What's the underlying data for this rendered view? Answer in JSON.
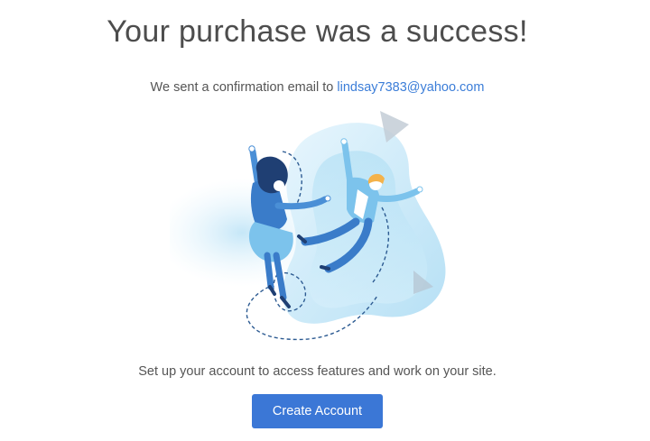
{
  "page": {
    "headline": "Your purchase was a success!",
    "confirmation_prefix": "We sent a confirmation email to ",
    "confirmation_email": "lindsay7383@yahoo.com",
    "setup_text": "Set up your account to access features and work on your site.",
    "create_account_label": "Create Account"
  },
  "illustration": {
    "icon": "celebration-illustration",
    "description_colors": {
      "blob_light": "#cfeaf8",
      "blob_mid": "#9fd4f0",
      "figure_dark": "#2f6db5",
      "figure_mid": "#4a8fd6",
      "figure_light": "#7cc3ec",
      "hair_dark": "#1f3f73",
      "hair_blond": "#f4b24a"
    }
  },
  "colors": {
    "accent": "#3b77d6",
    "link": "#3b7dd8",
    "text": "#555555",
    "headline": "#4d4d4d"
  }
}
